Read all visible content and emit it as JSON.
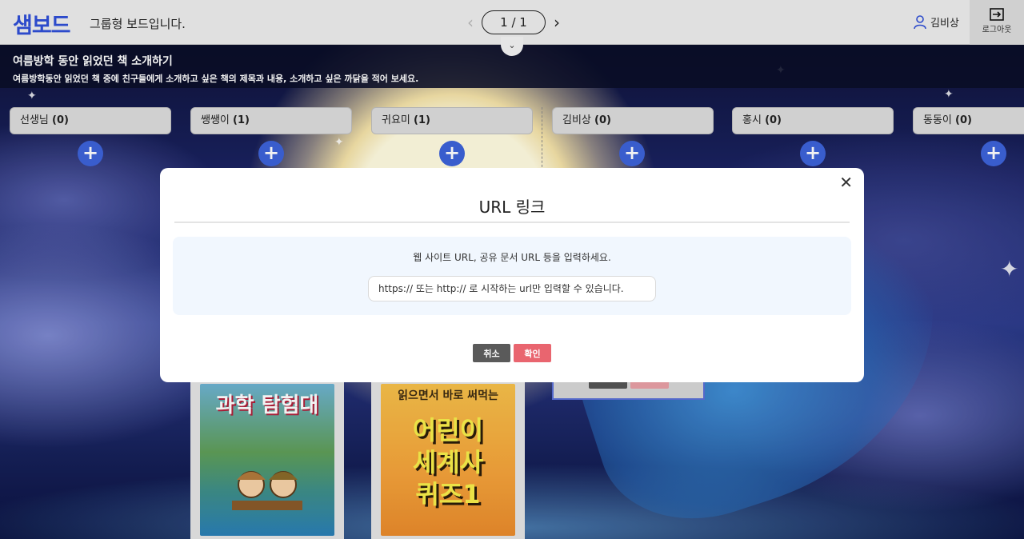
{
  "header": {
    "logo": "샘보드",
    "board_type": "그룹형 보드입니다.",
    "pager": {
      "prev": "‹",
      "next": "›",
      "current": "1 / 1"
    },
    "user_name": "김비상",
    "logout_label": "로그아웃"
  },
  "board": {
    "title": "여름방학 동안 읽었던 책 소개하기",
    "description": "여름방학동안 읽었던 책 중에 친구들에게 소개하고 싶은 책의 제목과 내용, 소개하고 싶은 까닭을 적어 보세요."
  },
  "columns": [
    {
      "name": "선생님",
      "count": "(0)"
    },
    {
      "name": "쌩쌩이",
      "count": "(1)"
    },
    {
      "name": "귀요미",
      "count": "(1)"
    },
    {
      "name": "김비상",
      "count": "(0)"
    },
    {
      "name": "홍시",
      "count": "(0)"
    },
    {
      "name": "동동이",
      "count": "(0)"
    }
  ],
  "add_label": "+",
  "cards": {
    "book1": {
      "title": "과학 탐험대"
    },
    "book2": {
      "small": "읽으면서 바로 써먹는",
      "big_line1": "어린이",
      "big_line2": "세계사",
      "big_line3": "퀴즈1"
    }
  },
  "modal": {
    "title": "URL 링크",
    "close": "✕",
    "description": "웹 사이트 URL, 공유 문서 URL 등을 입력하세요.",
    "input_value": "",
    "input_placeholder": "https:// 또는 http:// 로 시작하는 url만 입력할 수 있습니다.",
    "cancel_label": "취소",
    "ok_label": "확인"
  },
  "colors": {
    "brand": "#2f4fd6",
    "add_button": "#3d63d8",
    "cancel": "#5a5a5a",
    "ok": "#e9656f"
  }
}
